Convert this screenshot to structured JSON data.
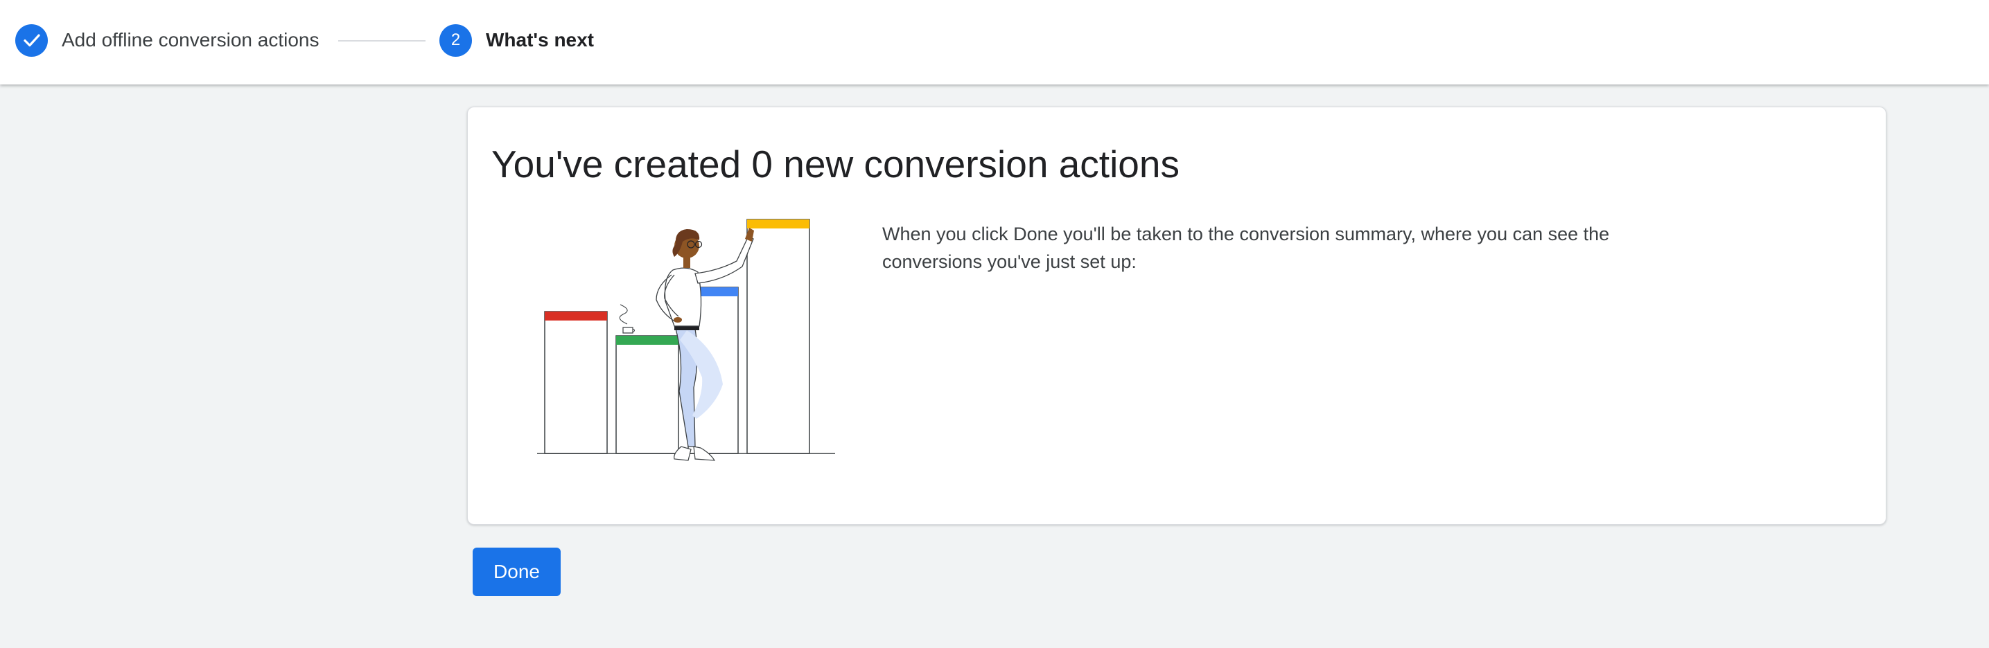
{
  "stepper": {
    "steps": [
      {
        "label": "Add offline conversion actions",
        "status": "completed",
        "icon": "check-icon"
      },
      {
        "number": "2",
        "label": "What's next",
        "status": "current"
      }
    ]
  },
  "card": {
    "title": "You've created 0 new conversion actions",
    "body": "When you click Done you'll be taken to the conversion summary, where you can see the conversions you've just set up:",
    "illustration": "woman-leaning-on-bar-chart-illustration"
  },
  "actions": {
    "done_label": "Done"
  },
  "colors": {
    "primary": "#1a73e8",
    "background": "#f1f3f4",
    "bar_red": "#d93025",
    "bar_green": "#34a853",
    "bar_blue": "#4285f4",
    "bar_yellow": "#fbbc04"
  }
}
